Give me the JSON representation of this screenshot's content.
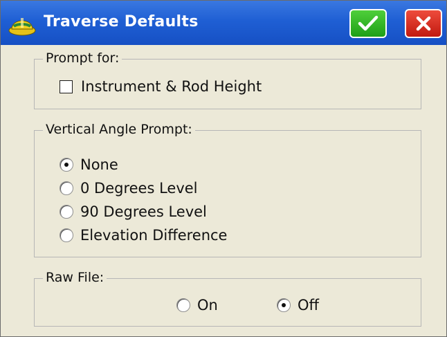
{
  "window": {
    "title": "Traverse Defaults"
  },
  "prompt_for": {
    "label": "Prompt for:",
    "instrument_rod_height": {
      "label": "Instrument & Rod Height",
      "checked": false
    }
  },
  "vertical_angle_prompt": {
    "label": "Vertical Angle Prompt:",
    "options": [
      {
        "label": "None",
        "selected": true
      },
      {
        "label": "0 Degrees Level",
        "selected": false
      },
      {
        "label": "90 Degrees Level",
        "selected": false
      },
      {
        "label": "Elevation Difference",
        "selected": false
      }
    ]
  },
  "raw_file": {
    "label": "Raw File:",
    "options": [
      {
        "label": "On",
        "selected": false
      },
      {
        "label": "Off",
        "selected": true
      }
    ]
  },
  "colors": {
    "titlebar": "#1f5fd4",
    "ok_button": "#1e9f17",
    "close_button": "#c11a10",
    "background": "#ece9d8"
  },
  "icons": {
    "app": "hard-hat-icon",
    "ok": "checkmark-icon",
    "close": "close-icon"
  }
}
